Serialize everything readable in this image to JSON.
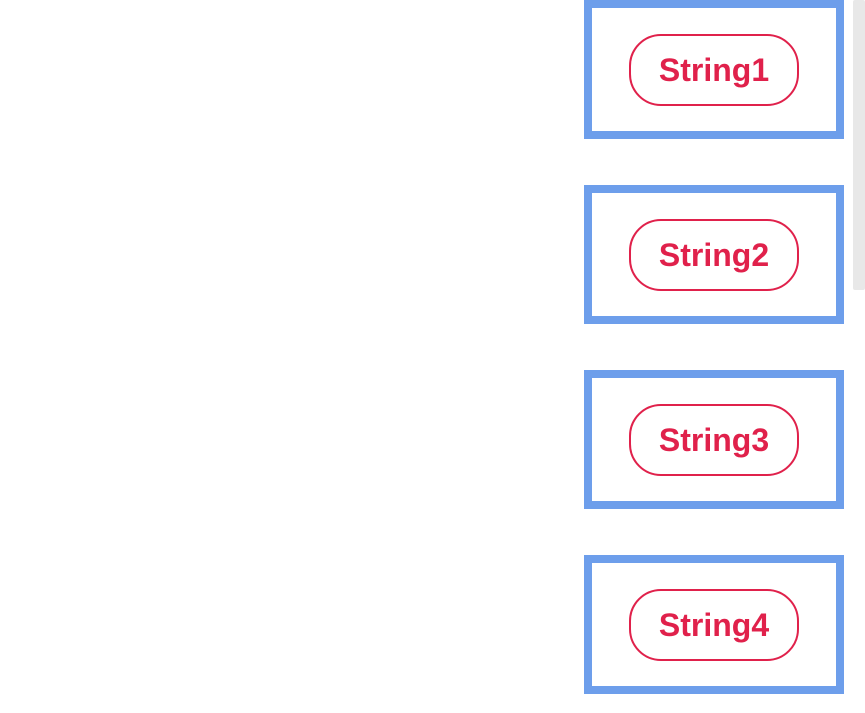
{
  "items": [
    {
      "label": "String1"
    },
    {
      "label": "String2"
    },
    {
      "label": "String3"
    },
    {
      "label": "String4"
    }
  ]
}
